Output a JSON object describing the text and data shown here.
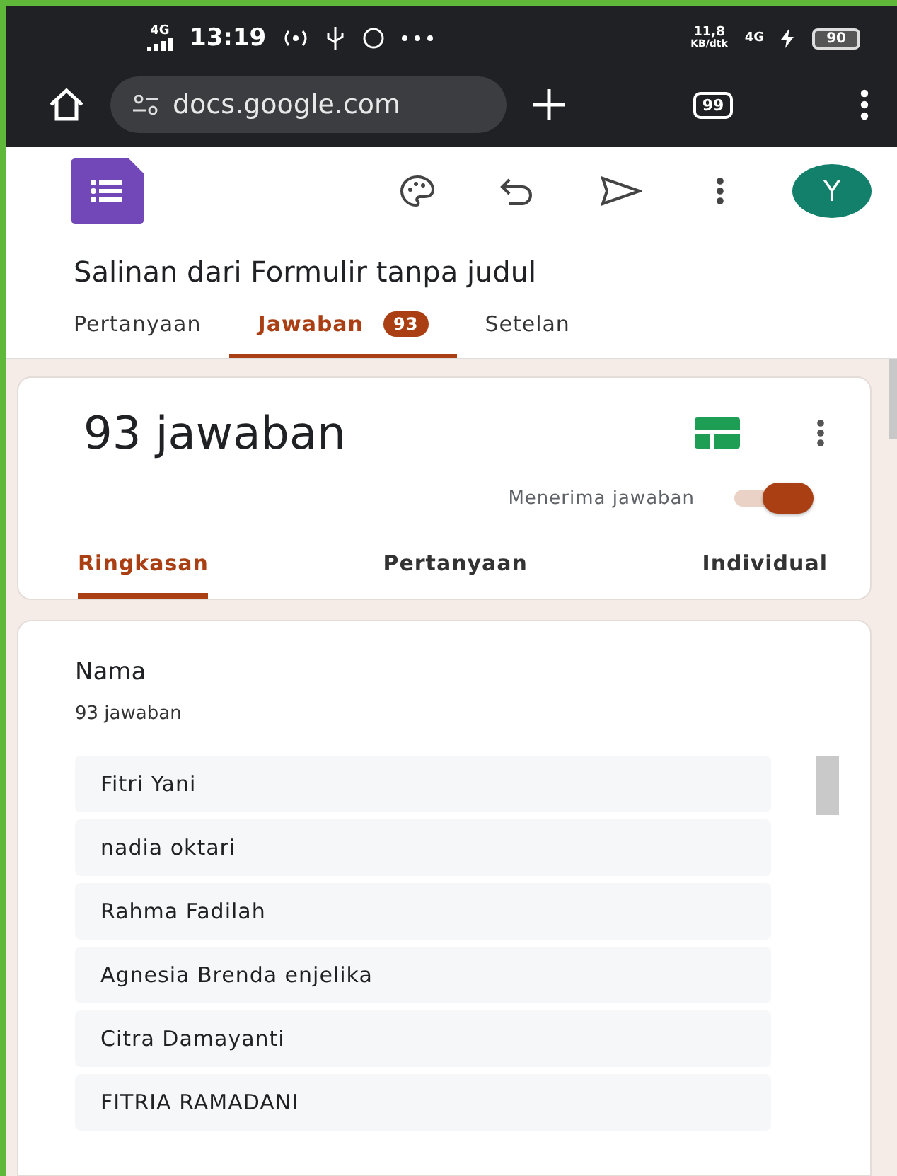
{
  "status_bar": {
    "signal_label": "4G",
    "time": "13:19",
    "speed": "11,8",
    "speed_unit": "KB/dtk",
    "network": "4G",
    "battery": "90"
  },
  "browser": {
    "url": "docs.google.com",
    "tab_count": "99"
  },
  "app_bar": {
    "avatar": "Y"
  },
  "form": {
    "title": "Salinan dari Formulir tanpa judul"
  },
  "tabs": [
    {
      "label": "Pertanyaan",
      "selected": false
    },
    {
      "label": "Jawaban",
      "badge": "93",
      "selected": true
    },
    {
      "label": "Setelan",
      "selected": false
    }
  ],
  "summary": {
    "heading": "93 jawaban",
    "accepting_label": "Menerima jawaban",
    "accepting_on": true
  },
  "sub_tabs": [
    {
      "label": "Ringkasan",
      "selected": true
    },
    {
      "label": "Pertanyaan",
      "selected": false
    },
    {
      "label": "Individual",
      "selected": false
    }
  ],
  "question": {
    "title": "Nama",
    "count": "93 jawaban",
    "answers": [
      "Fitri Yani",
      "nadia oktari",
      "Rahma Fadilah",
      "Agnesia Brenda enjelika",
      "Citra Damayanti",
      "FITRIA RAMADANI"
    ]
  }
}
